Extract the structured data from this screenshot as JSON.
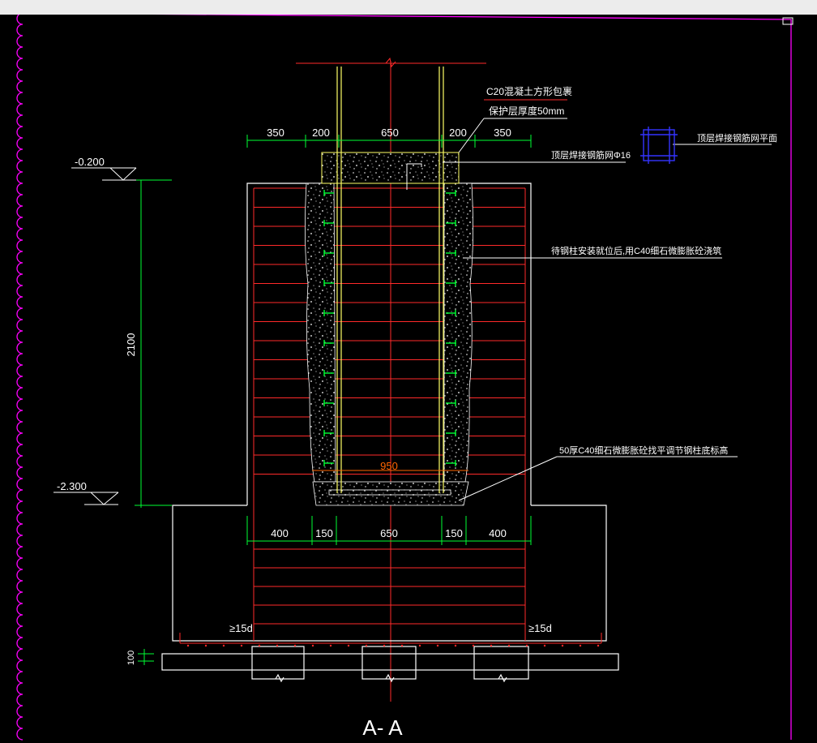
{
  "drawing": {
    "section_title": "A- A",
    "elevations": {
      "top": "-0.200",
      "bottom": "-2.300"
    },
    "dims_top": [
      "350",
      "200",
      "650",
      "200",
      "350"
    ],
    "dims_bottom": [
      "400",
      "150",
      "650",
      "150",
      "400"
    ],
    "dim_vertical": "2100",
    "dim_base": "100",
    "dim_socket_width": "950",
    "anchor_left": "≥15d",
    "anchor_right": "≥15d",
    "notes": {
      "c20_encasement": "C20混凝土方形包裹",
      "cover": "保护层厚度50mm",
      "top_mesh": "顶层焊接钢筋网Φ16",
      "grout_fill": "待钢柱安装就位后,用C40细石微膨胀砼浇筑",
      "base_grout": "50厚C40细石微膨胀砼找平调节钢柱底标高",
      "mesh_plan": "顶层焊接钢筋网平面"
    }
  },
  "colors": {
    "background": "#000000",
    "rebar": "#ff2a2a",
    "dimension": "#00ff33",
    "outline": "#ffffff",
    "column": "#ffff66",
    "frame": "#ff00ff",
    "plan": "#3333ff"
  }
}
